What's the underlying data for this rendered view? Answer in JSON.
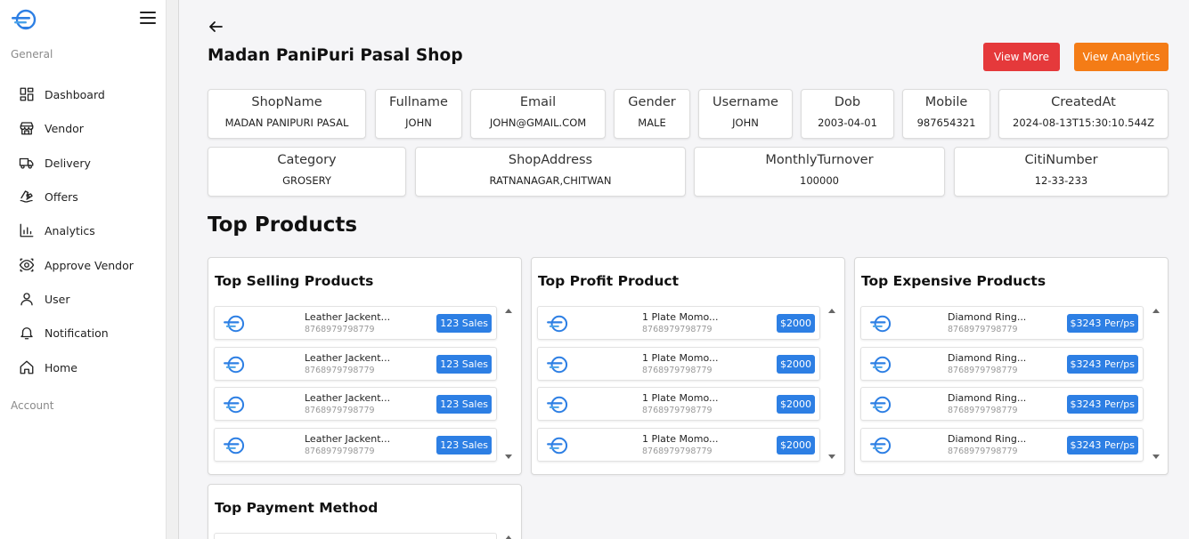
{
  "sidebar": {
    "general_label": "General",
    "account_label": "Account",
    "items": [
      {
        "label": "Dashboard",
        "icon": "dashboard-icon"
      },
      {
        "label": "Vendor",
        "icon": "store-icon"
      },
      {
        "label": "Delivery",
        "icon": "truck-icon"
      },
      {
        "label": "Offers",
        "icon": "offer-icon"
      },
      {
        "label": "Analytics",
        "icon": "bar-chart-icon"
      },
      {
        "label": "Approve Vendor",
        "icon": "eye-icon"
      },
      {
        "label": "User",
        "icon": "user-icon"
      },
      {
        "label": "Notification",
        "icon": "bell-icon"
      },
      {
        "label": "Home",
        "icon": "home-icon"
      }
    ]
  },
  "header": {
    "title": "Madan PaniPuri Pasal Shop",
    "view_more": "View More",
    "view_analytics": "View Analytics"
  },
  "info": {
    "row1": [
      {
        "key": "ShopName",
        "value": "MADAN PANIPURI PASAL"
      },
      {
        "key": "Fullname",
        "value": "JOHN"
      },
      {
        "key": "Email",
        "value": "JOHN@GMAIL.COM"
      },
      {
        "key": "Gender",
        "value": "MALE"
      },
      {
        "key": "Username",
        "value": "JOHN"
      },
      {
        "key": "Dob",
        "value": "2003-04-01"
      },
      {
        "key": "Mobile",
        "value": "987654321"
      },
      {
        "key": "CreatedAt",
        "value": "2024-08-13T15:30:10.544Z"
      }
    ],
    "row2": [
      {
        "key": "Category",
        "value": "GROSERY"
      },
      {
        "key": "ShopAddress",
        "value": "RATNANAGAR,CHITWAN"
      },
      {
        "key": "MonthlyTurnover",
        "value": "100000"
      },
      {
        "key": "CitiNumber",
        "value": "12-33-233"
      }
    ]
  },
  "top_products_title": "Top Products",
  "panels": {
    "selling": {
      "title": "Top Selling Products",
      "rows": [
        {
          "name": "Leather Jackent...",
          "sub": "8768979798779",
          "badge": "123 Sales"
        },
        {
          "name": "Leather Jackent...",
          "sub": "8768979798779",
          "badge": "123 Sales"
        },
        {
          "name": "Leather Jackent...",
          "sub": "8768979798779",
          "badge": "123 Sales"
        },
        {
          "name": "Leather Jackent...",
          "sub": "8768979798779",
          "badge": "123 Sales"
        }
      ]
    },
    "profit": {
      "title": "Top Profit Product",
      "rows": [
        {
          "name": "1 Plate Momo...",
          "sub": "8768979798779",
          "badge": "$2000"
        },
        {
          "name": "1 Plate Momo...",
          "sub": "8768979798779",
          "badge": "$2000"
        },
        {
          "name": "1 Plate Momo...",
          "sub": "8768979798779",
          "badge": "$2000"
        },
        {
          "name": "1 Plate Momo...",
          "sub": "8768979798779",
          "badge": "$2000"
        }
      ]
    },
    "expensive": {
      "title": "Top Expensive Products",
      "rows": [
        {
          "name": "Diamond Ring...",
          "sub": "8768979798779",
          "badge": "$3243 Per/ps"
        },
        {
          "name": "Diamond Ring...",
          "sub": "8768979798779",
          "badge": "$3243 Per/ps"
        },
        {
          "name": "Diamond Ring...",
          "sub": "8768979798779",
          "badge": "$3243 Per/ps"
        },
        {
          "name": "Diamond Ring...",
          "sub": "8768979798779",
          "badge": "$3243 Per/ps"
        }
      ]
    },
    "payment": {
      "title": "Top Payment Method"
    }
  },
  "colors": {
    "brand_blue": "#2d7fe4",
    "view_more_red": "#e5393b",
    "view_analytics_orange": "#f47c16"
  }
}
